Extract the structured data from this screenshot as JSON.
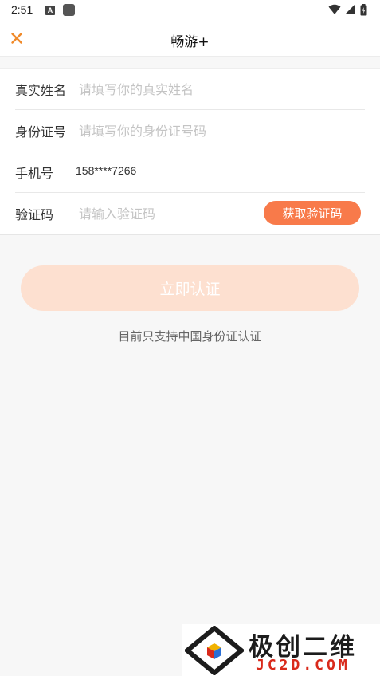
{
  "status_bar": {
    "time": "2:51",
    "icons": [
      "a-notification-icon",
      "app-notification-icon",
      "wifi-icon",
      "signal-icon",
      "battery-icon"
    ]
  },
  "header": {
    "title": "畅游+",
    "close_icon": "close-icon"
  },
  "form": {
    "rows": [
      {
        "label": "真实姓名",
        "placeholder": "请填写你的真实姓名",
        "value": ""
      },
      {
        "label": "身份证号",
        "placeholder": "请填写你的身份证号码",
        "value": ""
      },
      {
        "label": "手机号",
        "value": "158****7266"
      },
      {
        "label": "验证码",
        "placeholder": "请输入验证码",
        "value": "",
        "button_label": "获取验证码"
      }
    ]
  },
  "submit": {
    "label": "立即认证"
  },
  "notice": "目前只支持中国身份证认证",
  "watermark": {
    "title": "极创二维",
    "subtitle": "JC2D.COM"
  },
  "colors": {
    "accent": "#f87a4a",
    "close_icon": "#f08a2a",
    "submit_disabled": "#fde0d0",
    "page_bg": "#f7f7f7",
    "watermark_red": "#d92a1b"
  }
}
